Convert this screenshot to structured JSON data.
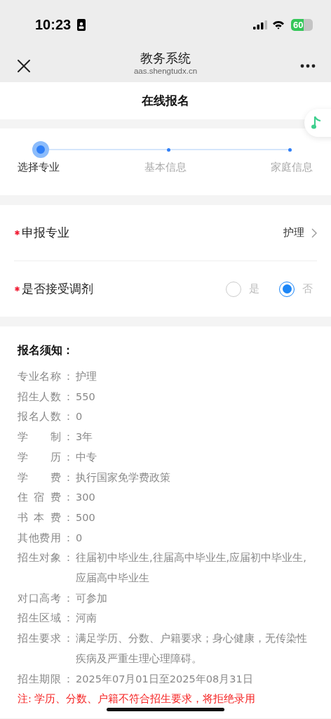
{
  "status_bar": {
    "time": "10:23",
    "battery": "60"
  },
  "nav": {
    "title": "教务系统",
    "url": "aas.shengtudx.cn"
  },
  "page_title": "在线报名",
  "steps": [
    {
      "label": "选择专业",
      "selected": true
    },
    {
      "label": "基本信息",
      "selected": false
    },
    {
      "label": "家庭信息",
      "selected": false
    }
  ],
  "form": {
    "major": {
      "label": "申报专业",
      "value": "护理"
    },
    "adjust": {
      "label": "是否接受调剂",
      "options": [
        {
          "label": "是",
          "selected": false
        },
        {
          "label": "否",
          "selected": true
        }
      ]
    }
  },
  "notice": {
    "title": "报名须知：",
    "items": [
      {
        "label": "专业名称",
        "sep": "：",
        "value": "护理"
      },
      {
        "label": "招生人数",
        "sep": "：",
        "value": "550"
      },
      {
        "label": "报名人数",
        "sep": "：",
        "value": "0"
      },
      {
        "label": "学 制",
        "sep": "：",
        "value": "3年"
      },
      {
        "label": "学 历",
        "sep": "：",
        "value": "中专"
      },
      {
        "label": "学 费",
        "sep": "：",
        "value": "执行国家免学费政策"
      },
      {
        "label": "住 宿 费",
        "sep": "：",
        "value": "300"
      },
      {
        "label": "书 本 费",
        "sep": "：",
        "value": "500"
      },
      {
        "label": "其他费用",
        "sep": "：",
        "value": "0"
      },
      {
        "label": "招生对象",
        "sep": "：",
        "value": "往届初中毕业生,往届高中毕业生,应届初中毕业生,应届高中毕业生"
      },
      {
        "label": "对口高考",
        "sep": "：",
        "value": "可参加"
      },
      {
        "label": "招生区域",
        "sep": "：",
        "value": "河南"
      },
      {
        "label": "招生要求",
        "sep": "：",
        "value": "满足学历、分数、户籍要求；身心健康，无传染性疾病及严重生理心理障碍。"
      },
      {
        "label": "招生期限",
        "sep": "：",
        "value": "2025年07月01日至2025年08月31日"
      }
    ],
    "warning": "注: 学历、分数、户籍不符合招生要求，将拒绝录用"
  }
}
